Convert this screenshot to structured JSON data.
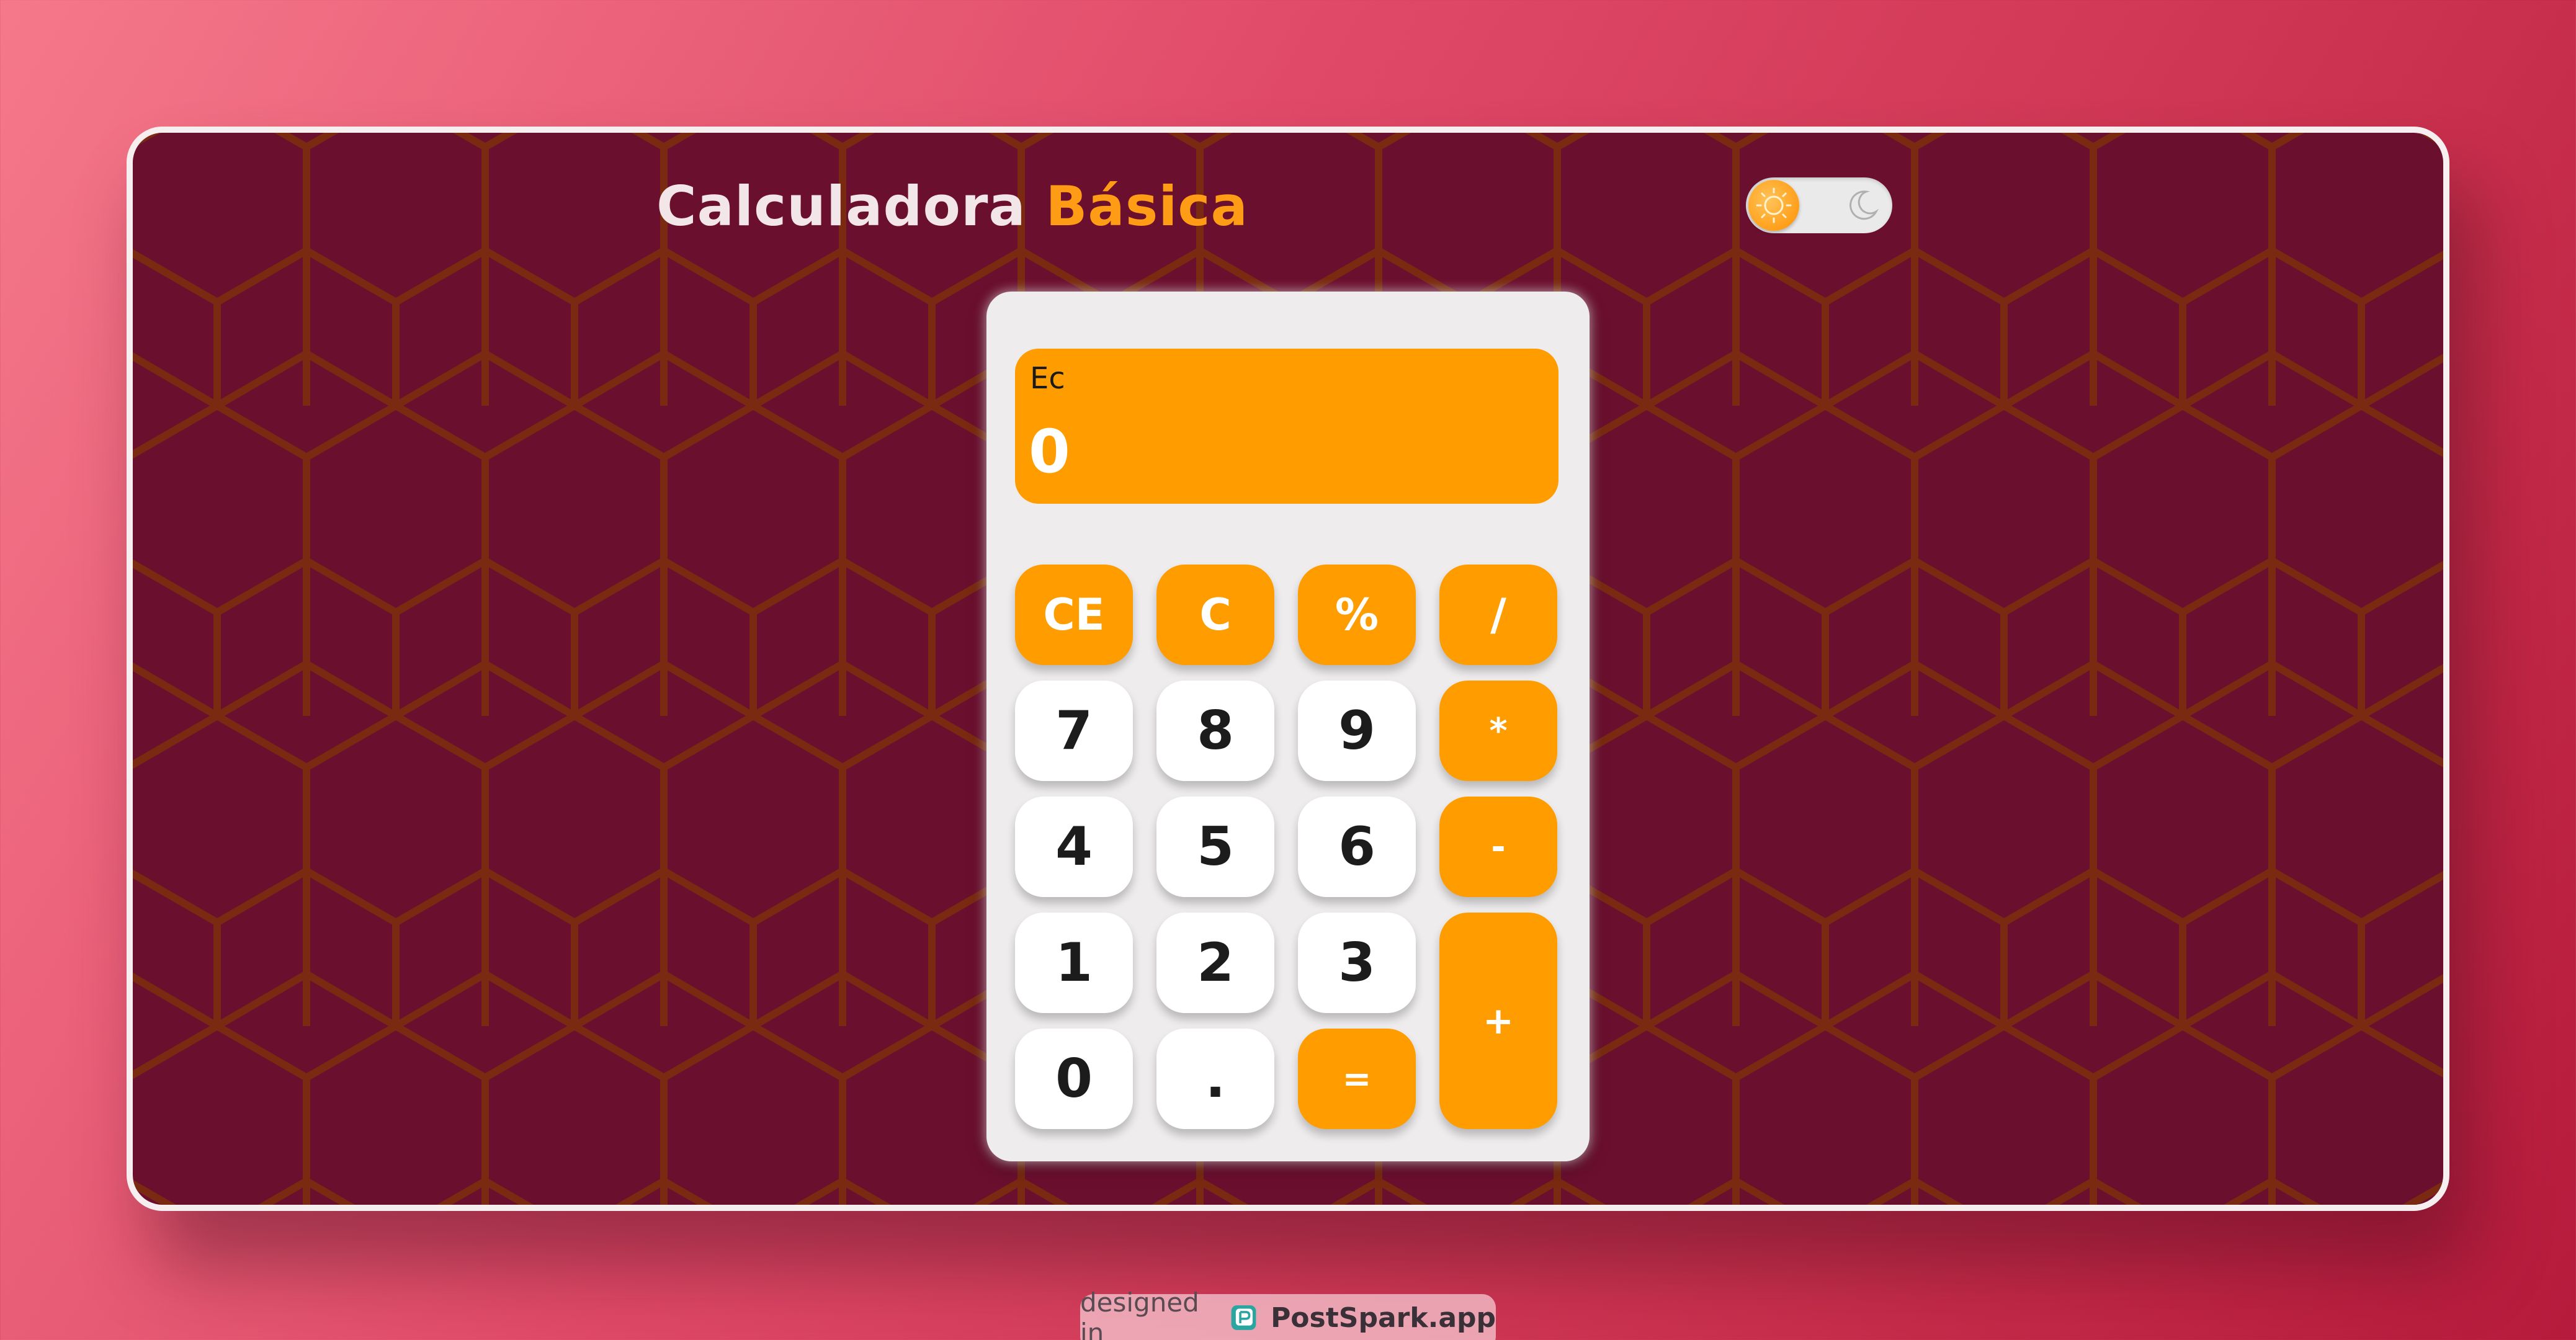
{
  "app": {
    "title_main": "Calculadora",
    "title_accent": "Básica"
  },
  "theme_toggle": {
    "state": "light",
    "light_icon": "sun-icon",
    "dark_icon": "moon-icon"
  },
  "display": {
    "label": "Ec",
    "value": "0"
  },
  "keys": {
    "ce": "CE",
    "c": "C",
    "percent": "%",
    "divide": "/",
    "seven": "7",
    "eight": "8",
    "nine": "9",
    "multiply": "*",
    "four": "4",
    "five": "5",
    "six": "6",
    "subtract": "-",
    "one": "1",
    "two": "2",
    "three": "3",
    "add": "+",
    "zero": "0",
    "decimal": ".",
    "equals": "="
  },
  "footer": {
    "prefix": "designed in",
    "brand": "PostSpark.app",
    "logo_icon": "postspark-logo-icon"
  },
  "colors": {
    "accent": "#ff9c00",
    "background_panel": "#6b0f2e",
    "hex_lines": "#7a2a10",
    "calculator_body": "#eeeced",
    "key_light": "#ffffff",
    "title_text": "#f2e6e9"
  }
}
